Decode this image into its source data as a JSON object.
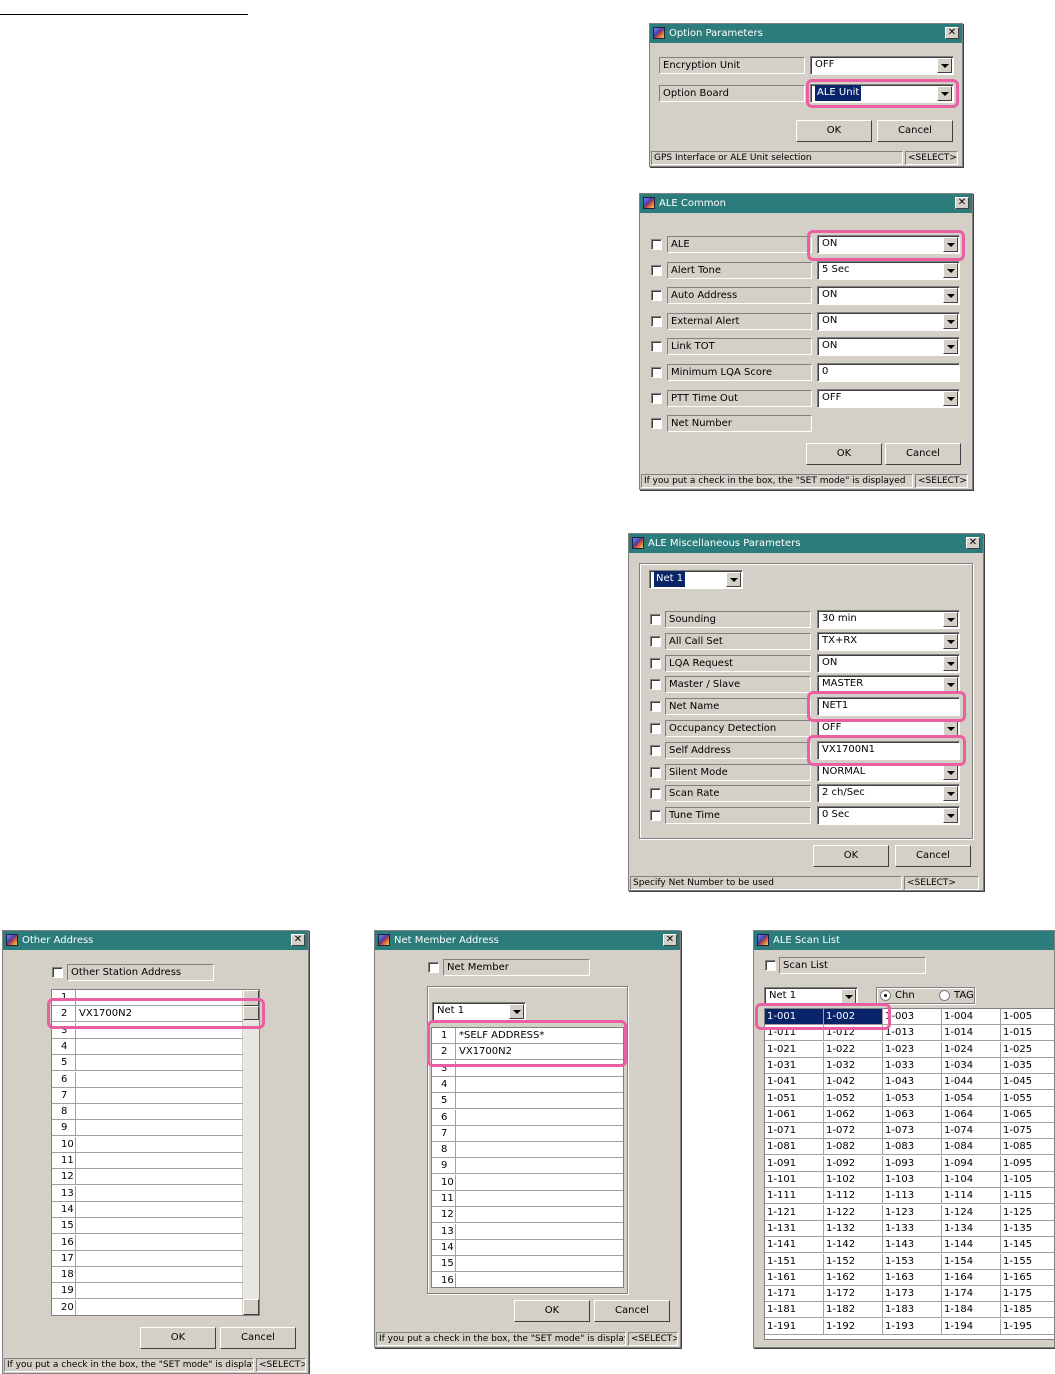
{
  "option_parameters": {
    "title": "Option Parameters",
    "rows": [
      {
        "label": "Encryption Unit",
        "value": "OFF"
      },
      {
        "label": "Option Board",
        "value": "ALE Unit"
      }
    ],
    "ok": "OK",
    "cancel": "Cancel",
    "status": "GPS Interface or ALE Unit selection",
    "status_right": "<SELECT>"
  },
  "ale_common": {
    "title": "ALE Common",
    "rows": [
      {
        "label": "ALE",
        "value": "ON",
        "kind": "combo"
      },
      {
        "label": "Alert Tone",
        "value": "5 Sec",
        "kind": "combo"
      },
      {
        "label": "Auto Address",
        "value": "ON",
        "kind": "combo"
      },
      {
        "label": "External Alert",
        "value": "ON",
        "kind": "combo"
      },
      {
        "label": "Link TOT",
        "value": "ON",
        "kind": "combo"
      },
      {
        "label": "Minimum LQA Score",
        "value": "0",
        "kind": "text"
      },
      {
        "label": "PTT Time Out",
        "value": "OFF",
        "kind": "combo"
      },
      {
        "label": "Net Number",
        "value": "",
        "kind": "none"
      }
    ],
    "ok": "OK",
    "cancel": "Cancel",
    "status": "If you put a check in the box, the \"SET mode\" is displayed",
    "status_right": "<SELECT>"
  },
  "ale_misc": {
    "title": "ALE Miscellaneous Parameters",
    "net_select": "Net 1",
    "rows": [
      {
        "label": "Sounding",
        "value": "30 min",
        "kind": "combo"
      },
      {
        "label": "All Call Set",
        "value": "TX+RX",
        "kind": "combo"
      },
      {
        "label": "LQA Request",
        "value": "ON",
        "kind": "combo"
      },
      {
        "label": "Master / Slave",
        "value": "MASTER",
        "kind": "combo"
      },
      {
        "label": "Net Name",
        "value": "NET1",
        "kind": "text"
      },
      {
        "label": "Occupancy Detection",
        "value": "OFF",
        "kind": "combo"
      },
      {
        "label": "Self Address",
        "value": "VX1700N1",
        "kind": "text"
      },
      {
        "label": "Silent Mode",
        "value": "NORMAL",
        "kind": "combo"
      },
      {
        "label": "Scan Rate",
        "value": "2 ch/Sec",
        "kind": "combo"
      },
      {
        "label": "Tune Time",
        "value": "0 Sec",
        "kind": "combo"
      }
    ],
    "ok": "OK",
    "cancel": "Cancel",
    "status": "Specify Net Number to be used",
    "status_right": "<SELECT>"
  },
  "other_address": {
    "title": "Other Address",
    "check_label": "Other Station Address",
    "rows": [
      {
        "n": "1",
        "v": ""
      },
      {
        "n": "2",
        "v": "VX1700N2"
      },
      {
        "n": "3",
        "v": ""
      },
      {
        "n": "4",
        "v": ""
      },
      {
        "n": "5",
        "v": ""
      },
      {
        "n": "6",
        "v": ""
      },
      {
        "n": "7",
        "v": ""
      },
      {
        "n": "8",
        "v": ""
      },
      {
        "n": "9",
        "v": ""
      },
      {
        "n": "10",
        "v": ""
      },
      {
        "n": "11",
        "v": ""
      },
      {
        "n": "12",
        "v": ""
      },
      {
        "n": "13",
        "v": ""
      },
      {
        "n": "14",
        "v": ""
      },
      {
        "n": "15",
        "v": ""
      },
      {
        "n": "16",
        "v": ""
      },
      {
        "n": "17",
        "v": ""
      },
      {
        "n": "18",
        "v": ""
      },
      {
        "n": "19",
        "v": ""
      },
      {
        "n": "20",
        "v": ""
      }
    ],
    "ok": "OK",
    "cancel": "Cancel",
    "status": "If you put a check in the box, the \"SET mode\" is displayed",
    "status_right": "<SELECT>"
  },
  "net_member": {
    "title": "Net Member Address",
    "check_label": "Net Member",
    "net_select": "Net 1",
    "rows": [
      {
        "n": "1",
        "v": "*SELF ADDRESS*"
      },
      {
        "n": "2",
        "v": "VX1700N2"
      },
      {
        "n": "3",
        "v": ""
      },
      {
        "n": "4",
        "v": ""
      },
      {
        "n": "5",
        "v": ""
      },
      {
        "n": "6",
        "v": ""
      },
      {
        "n": "7",
        "v": ""
      },
      {
        "n": "8",
        "v": ""
      },
      {
        "n": "9",
        "v": ""
      },
      {
        "n": "10",
        "v": ""
      },
      {
        "n": "11",
        "v": ""
      },
      {
        "n": "12",
        "v": ""
      },
      {
        "n": "13",
        "v": ""
      },
      {
        "n": "14",
        "v": ""
      },
      {
        "n": "15",
        "v": ""
      },
      {
        "n": "16",
        "v": ""
      }
    ],
    "ok": "OK",
    "cancel": "Cancel",
    "status": "If you put a check in the box, the \"SET mode\" is displayed",
    "status_right": "<SELECT>"
  },
  "ale_scan": {
    "title": "ALE Scan List",
    "check_label": "Scan List",
    "net_select": "Net 1",
    "radio_chn": "Chn",
    "radio_tag": "TAG",
    "rows": [
      [
        "1-001",
        "1-002",
        "1-003",
        "1-004",
        "1-005"
      ],
      [
        "1-011",
        "1-012",
        "1-013",
        "1-014",
        "1-015"
      ],
      [
        "1-021",
        "1-022",
        "1-023",
        "1-024",
        "1-025"
      ],
      [
        "1-031",
        "1-032",
        "1-033",
        "1-034",
        "1-035"
      ],
      [
        "1-041",
        "1-042",
        "1-043",
        "1-044",
        "1-045"
      ],
      [
        "1-051",
        "1-052",
        "1-053",
        "1-054",
        "1-055"
      ],
      [
        "1-061",
        "1-062",
        "1-063",
        "1-064",
        "1-065"
      ],
      [
        "1-071",
        "1-072",
        "1-073",
        "1-074",
        "1-075"
      ],
      [
        "1-081",
        "1-082",
        "1-083",
        "1-084",
        "1-085"
      ],
      [
        "1-091",
        "1-092",
        "1-093",
        "1-094",
        "1-095"
      ],
      [
        "1-101",
        "1-102",
        "1-103",
        "1-104",
        "1-105"
      ],
      [
        "1-111",
        "1-112",
        "1-113",
        "1-114",
        "1-115"
      ],
      [
        "1-121",
        "1-122",
        "1-123",
        "1-124",
        "1-125"
      ],
      [
        "1-131",
        "1-132",
        "1-133",
        "1-134",
        "1-135"
      ],
      [
        "1-141",
        "1-142",
        "1-143",
        "1-144",
        "1-145"
      ],
      [
        "1-151",
        "1-152",
        "1-153",
        "1-154",
        "1-155"
      ],
      [
        "1-161",
        "1-162",
        "1-163",
        "1-164",
        "1-165"
      ],
      [
        "1-171",
        "1-172",
        "1-173",
        "1-174",
        "1-175"
      ],
      [
        "1-181",
        "1-182",
        "1-183",
        "1-184",
        "1-185"
      ],
      [
        "1-191",
        "1-192",
        "1-193",
        "1-194",
        "1-195"
      ]
    ],
    "selected_cells": [
      "1-001",
      "1-002"
    ]
  },
  "colors": {
    "titlebar": "#2c7c7c",
    "highlight": "#ea5fa2",
    "selection": "#0a246a",
    "dialog": "#d4d0c8"
  }
}
